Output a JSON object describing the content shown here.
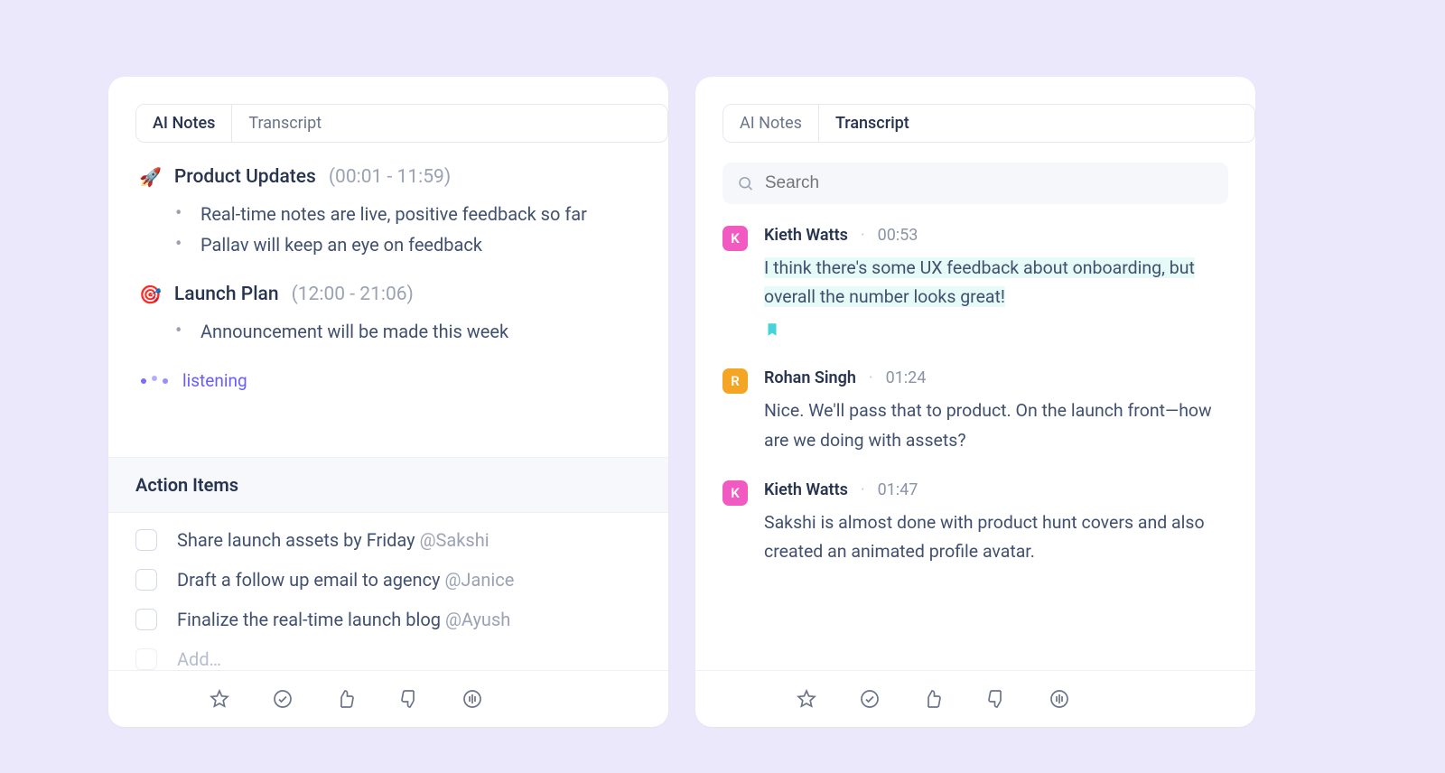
{
  "tabs": {
    "ai_notes": "AI Notes",
    "transcript": "Transcript"
  },
  "notes": {
    "sections": [
      {
        "emoji": "🚀",
        "title": "Product Updates",
        "time": "(00:01 - 11:59)",
        "bullets": [
          "Real-time notes are live, positive feedback so far",
          "Pallav will keep an eye on feedback"
        ]
      },
      {
        "emoji": "🎯",
        "title": "Launch Plan",
        "time": "(12:00 - 21:06)",
        "bullets": [
          "Announcement will be made this week"
        ]
      }
    ],
    "listening": "listening",
    "action_heading": "Action Items",
    "actions": [
      {
        "text": "Share launch assets by Friday ",
        "mention": "@Sakshi"
      },
      {
        "text": "Draft a follow up email to agency ",
        "mention": "@Janice"
      },
      {
        "text": "Finalize the real-time launch blog ",
        "mention": "@Ayush"
      }
    ],
    "add_placeholder": "Add…"
  },
  "search": {
    "placeholder": "Search"
  },
  "transcript": [
    {
      "initial": "K",
      "avatar_color": "pink",
      "speaker": "Kieth Watts",
      "time": "00:53",
      "text": "I think there's some UX feedback about onboarding, but overall the number looks great!",
      "highlighted": true,
      "bookmarked": true
    },
    {
      "initial": "R",
      "avatar_color": "orange",
      "speaker": "Rohan Singh",
      "time": "01:24",
      "text": "Nice. We'll pass that to product. On the launch front—how are we doing with assets?",
      "highlighted": false,
      "bookmarked": false
    },
    {
      "initial": "K",
      "avatar_color": "pink",
      "speaker": "Kieth Watts",
      "time": "01:47",
      "text": "Sakshi is almost done with product hunt covers and also created an animated profile avatar.",
      "highlighted": false,
      "bookmarked": false
    }
  ]
}
